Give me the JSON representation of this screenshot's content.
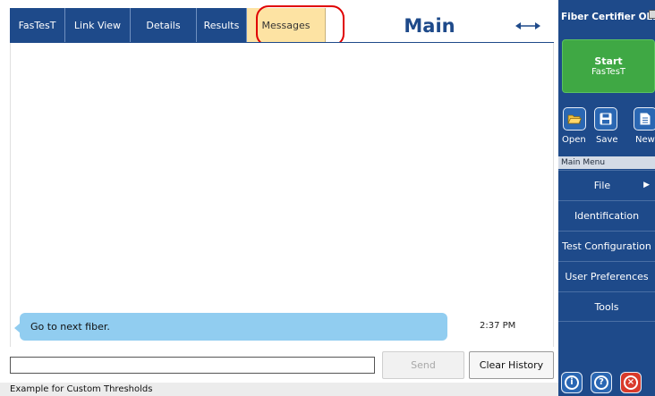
{
  "tabs": [
    {
      "label": "FasTesT"
    },
    {
      "label": "Link View"
    },
    {
      "label": "Details"
    },
    {
      "label": "Results"
    },
    {
      "label": "Messages",
      "active": true
    }
  ],
  "main": {
    "title": "Main",
    "expand_icon": "double-arrow-icon"
  },
  "messages": {
    "items": [
      {
        "text": "Go to next fiber.",
        "time": "2:37 PM"
      }
    ],
    "input_value": "",
    "send_label": "Send",
    "clear_label": "Clear History"
  },
  "status_bar": {
    "text": "Example for Custom Thresholds"
  },
  "sidebar": {
    "app_title": "Fiber Certifier OLTS",
    "start": {
      "label": "Start",
      "sub": "FasTesT"
    },
    "file_buttons": [
      {
        "label": "Open",
        "icon": "folder-open-icon"
      },
      {
        "label": "Save",
        "icon": "floppy-disk-icon"
      },
      {
        "label": "New",
        "icon": "new-document-icon"
      }
    ],
    "menu_header": "Main Menu",
    "menu": [
      {
        "label": "File",
        "has_submenu": true
      },
      {
        "label": "Identification"
      },
      {
        "label": "Test Configuration"
      },
      {
        "label": "User Preferences"
      },
      {
        "label": "Tools"
      }
    ],
    "bottom_buttons": [
      {
        "icon": "info-icon",
        "glyph": "i"
      },
      {
        "icon": "help-icon",
        "glyph": "?"
      },
      {
        "icon": "close-icon",
        "glyph": "×"
      }
    ]
  },
  "colors": {
    "brand_blue": "#1e4a8a",
    "active_tab": "#fde3a3",
    "start_green": "#3fa844",
    "bubble_blue": "#91cdf0",
    "highlight_red": "#e00000",
    "close_red": "#d93a2b"
  }
}
